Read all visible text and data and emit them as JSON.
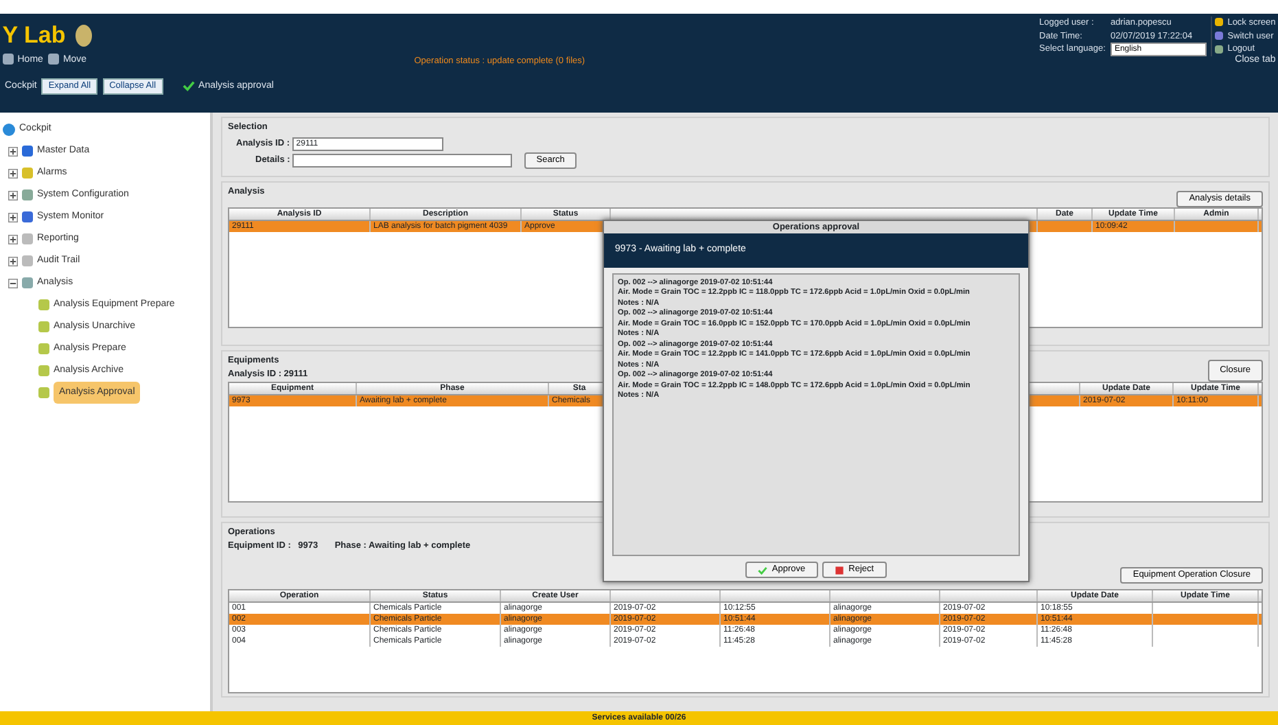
{
  "app": {
    "title": "Y Lab",
    "toolbar": [
      "Home",
      "Move"
    ],
    "status": "Operation status : update complete (0 files)",
    "close_tab": "Close tab"
  },
  "user": {
    "labels": [
      "Logged user :",
      "Date Time:",
      "Select language:"
    ],
    "user": "adrian.popescu",
    "datetime": "02/07/2019 17:22:04",
    "language": "English",
    "links": [
      "Lock screen",
      "Switch user",
      "Logout"
    ]
  },
  "tabbar": {
    "title": "Cockpit",
    "buttons": [
      "Expand All",
      "Collapse All"
    ],
    "page": "Analysis approval"
  },
  "tree": {
    "root": "Cockpit",
    "items": [
      {
        "label": "Master Data",
        "expanded": false,
        "selected": false
      },
      {
        "label": "Alarms",
        "expanded": false,
        "selected": false
      },
      {
        "label": "System Configuration",
        "expanded": false,
        "selected": false
      },
      {
        "label": "System Monitor",
        "expanded": false,
        "selected": false
      },
      {
        "label": "Reporting",
        "expanded": false,
        "selected": false
      },
      {
        "label": "Audit Trail",
        "expanded": false,
        "selected": false
      },
      {
        "label": "Analysis",
        "expanded": true,
        "selected": false,
        "children": [
          {
            "label": "Analysis Equipment Prepare",
            "selected": false
          },
          {
            "label": "Analysis Unarchive",
            "selected": false
          },
          {
            "label": "Analysis Prepare",
            "selected": false
          },
          {
            "label": "Analysis Archive",
            "selected": false
          },
          {
            "label": "Analysis Approval",
            "selected": true
          }
        ]
      }
    ]
  },
  "selection": {
    "title": "Selection",
    "analysis_label": "Analysis ID :",
    "analysis_value": "29111",
    "details_label": "Details :",
    "search": "Search"
  },
  "analysis": {
    "title": "Analysis",
    "button": "Analysis details",
    "columns": [
      {
        "label": "Analysis ID"
      },
      {
        "label": "Description"
      },
      {
        "label": "Status"
      },
      {},
      {
        "label": "Date"
      },
      {
        "label": "Update Time"
      },
      {
        "label": "Admin"
      }
    ],
    "rows": [
      {
        "selected": true,
        "cells": [
          "29111",
          "LAB analysis for batch pigment 4039",
          "Approve",
          null,
          null,
          "10:09:42",
          null
        ]
      }
    ]
  },
  "equipments": {
    "title": "Equipments",
    "id_label": "Analysis ID :",
    "id_value": "29111",
    "button": "Closure",
    "columns": [
      {
        "label": "Equipment"
      },
      {
        "label": "Phase"
      },
      {
        "label": "Sta"
      },
      {},
      {
        "label": "Update Date"
      },
      {
        "label": "Update Time"
      }
    ],
    "rows": [
      {
        "selected": true,
        "cells": [
          "9973",
          "Awaiting lab + complete",
          "Chemicals",
          null,
          "2019-07-02",
          "10:11:00"
        ]
      }
    ]
  },
  "operations": {
    "title": "Operations",
    "id_label": "Equipment ID :",
    "id_value": "9973",
    "phase": "Phase : Awaiting lab + complete",
    "button": "Equipment Operation Closure",
    "columns": [
      {
        "label": "Operation"
      },
      {
        "label": "Status"
      },
      {
        "label": "Create User"
      },
      {},
      {},
      {},
      {},
      {
        "label": "Update Date"
      },
      {
        "label": "Update Time"
      }
    ],
    "rows": [
      {
        "selected": false,
        "cells": [
          "001",
          "Chemicals Particle",
          "alinagorge",
          "2019-07-02",
          "10:12:55",
          "alinagorge",
          "2019-07-02",
          "10:18:55"
        ]
      },
      {
        "selected": true,
        "cells": [
          "002",
          "Chemicals Particle",
          "alinagorge",
          "2019-07-02",
          "10:51:44",
          "alinagorge",
          "2019-07-02",
          "10:51:44"
        ]
      },
      {
        "selected": false,
        "cells": [
          "003",
          "Chemicals Particle",
          "alinagorge",
          "2019-07-02",
          "11:26:48",
          "alinagorge",
          "2019-07-02",
          "11:26:48"
        ]
      },
      {
        "selected": false,
        "cells": [
          "004",
          "Chemicals Particle",
          "alinagorge",
          "2019-07-02",
          "11:45:28",
          "alinagorge",
          "2019-07-02",
          "11:45:28"
        ]
      }
    ]
  },
  "dialog": {
    "title": "Operations approval",
    "header": "9973 - Awaiting lab + complete",
    "lines": [
      "Op. 002 --> alinagorge 2019-07-02 10:51:44",
      "Air. Mode = Grain TOC = 12.2ppb IC = 118.0ppb TC = 172.6ppb Acid = 1.0pL/min Oxid = 0.0pL/min",
      "Notes : N/A",
      "Op. 002 --> alinagorge 2019-07-02 10:51:44",
      "Air. Mode = Grain TOC = 16.0ppb IC = 152.0ppb TC = 170.0ppb Acid = 1.0pL/min Oxid = 0.0pL/min",
      "Notes : N/A",
      "Op. 002 --> alinagorge 2019-07-02 10:51:44",
      "Air. Mode = Grain TOC = 12.2ppb IC = 141.0ppb TC = 172.6ppb Acid = 1.0pL/min Oxid = 0.0pL/min",
      "Notes : N/A",
      "Op. 002 --> alinagorge 2019-07-02 10:51:44",
      "Air. Mode = Grain TOC = 12.2ppb IC = 148.0ppb TC = 172.6ppb Acid = 1.0pL/min Oxid = 0.0pL/min",
      "Notes : N/A"
    ],
    "buttons": [
      {
        "label": "Approve",
        "kind": "approve"
      },
      {
        "label": "Reject",
        "kind": "reject"
      }
    ]
  },
  "footer": "Services available 00/26"
}
